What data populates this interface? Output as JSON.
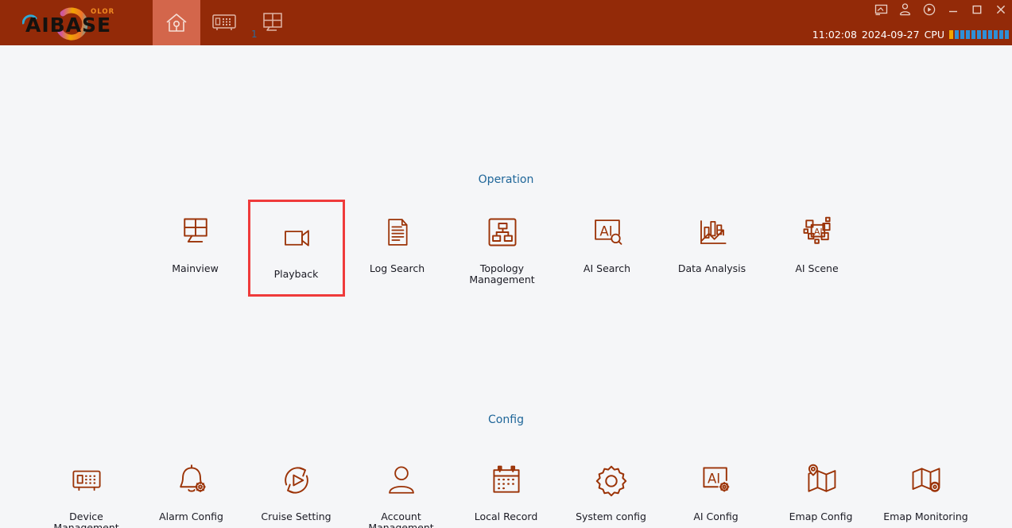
{
  "titlebar": {
    "logo": {
      "text": "AIBASE",
      "accent_text": "OLOR",
      "name": "aibase-logo"
    },
    "nav_tabs": [
      {
        "icon": "home-icon",
        "label": "",
        "active": true,
        "badge": ""
      },
      {
        "icon": "device-icon",
        "label": "",
        "active": false,
        "badge": ""
      },
      {
        "icon": "grid-view-icon",
        "label": "",
        "active": false,
        "badge": "1"
      }
    ],
    "window_controls": [
      {
        "icon": "screen-icon",
        "name": "screen-button"
      },
      {
        "icon": "user-icon",
        "name": "user-button"
      },
      {
        "icon": "help-icon",
        "name": "help-button"
      },
      {
        "icon": "minimize-icon",
        "name": "minimize-button"
      },
      {
        "icon": "maximize-icon",
        "name": "maximize-button"
      },
      {
        "icon": "close-icon",
        "name": "close-button"
      }
    ],
    "status": {
      "time": "11:02:08",
      "date": "2024-09-27",
      "cpu_label": "CPU",
      "cpu_segments": 11,
      "cpu_first_color": "#f0a400",
      "cpu_color": "#2f8fd6"
    }
  },
  "sections": [
    {
      "title": "Operation",
      "tiles": [
        {
          "label": "Mainview",
          "icon": "mainview-icon",
          "selected": false
        },
        {
          "label": "Playback",
          "icon": "playback-camera-icon",
          "selected": true
        },
        {
          "label": "Log Search",
          "icon": "log-search-document-icon",
          "selected": false
        },
        {
          "label": "Topology Management",
          "icon": "topology-icon",
          "selected": false
        },
        {
          "label": "AI Search",
          "icon": "ai-search-icon",
          "selected": false
        },
        {
          "label": "Data Analysis",
          "icon": "data-analysis-chart-icon",
          "selected": false
        },
        {
          "label": "AI Scene",
          "icon": "ai-scene-icon",
          "selected": false
        }
      ]
    },
    {
      "title": "Config",
      "tiles": [
        {
          "label": "Device Management",
          "icon": "device-management-icon",
          "selected": false
        },
        {
          "label": "Alarm Config",
          "icon": "alarm-bell-gear-icon",
          "selected": false
        },
        {
          "label": "Cruise Setting",
          "icon": "cruise-play-refresh-icon",
          "selected": false
        },
        {
          "label": "Account Management",
          "icon": "account-person-icon",
          "selected": false
        },
        {
          "label": "Local Record",
          "icon": "calendar-icon",
          "selected": false
        },
        {
          "label": "System config",
          "icon": "gear-icon",
          "selected": false
        },
        {
          "label": "AI Config",
          "icon": "ai-gear-icon",
          "selected": false
        },
        {
          "label": "Emap Config",
          "icon": "map-pin-icon",
          "selected": false
        },
        {
          "label": "Emap Monitoring",
          "icon": "map-eye-icon",
          "selected": false
        }
      ]
    }
  ],
  "colors": {
    "titlebar_bg": "#932a08",
    "active_tab_bg": "#d3664b",
    "page_bg": "#f5f6f8",
    "icon_stroke": "#9b3307",
    "section_title": "#1f6699",
    "selection_border": "#ef3b3b"
  }
}
